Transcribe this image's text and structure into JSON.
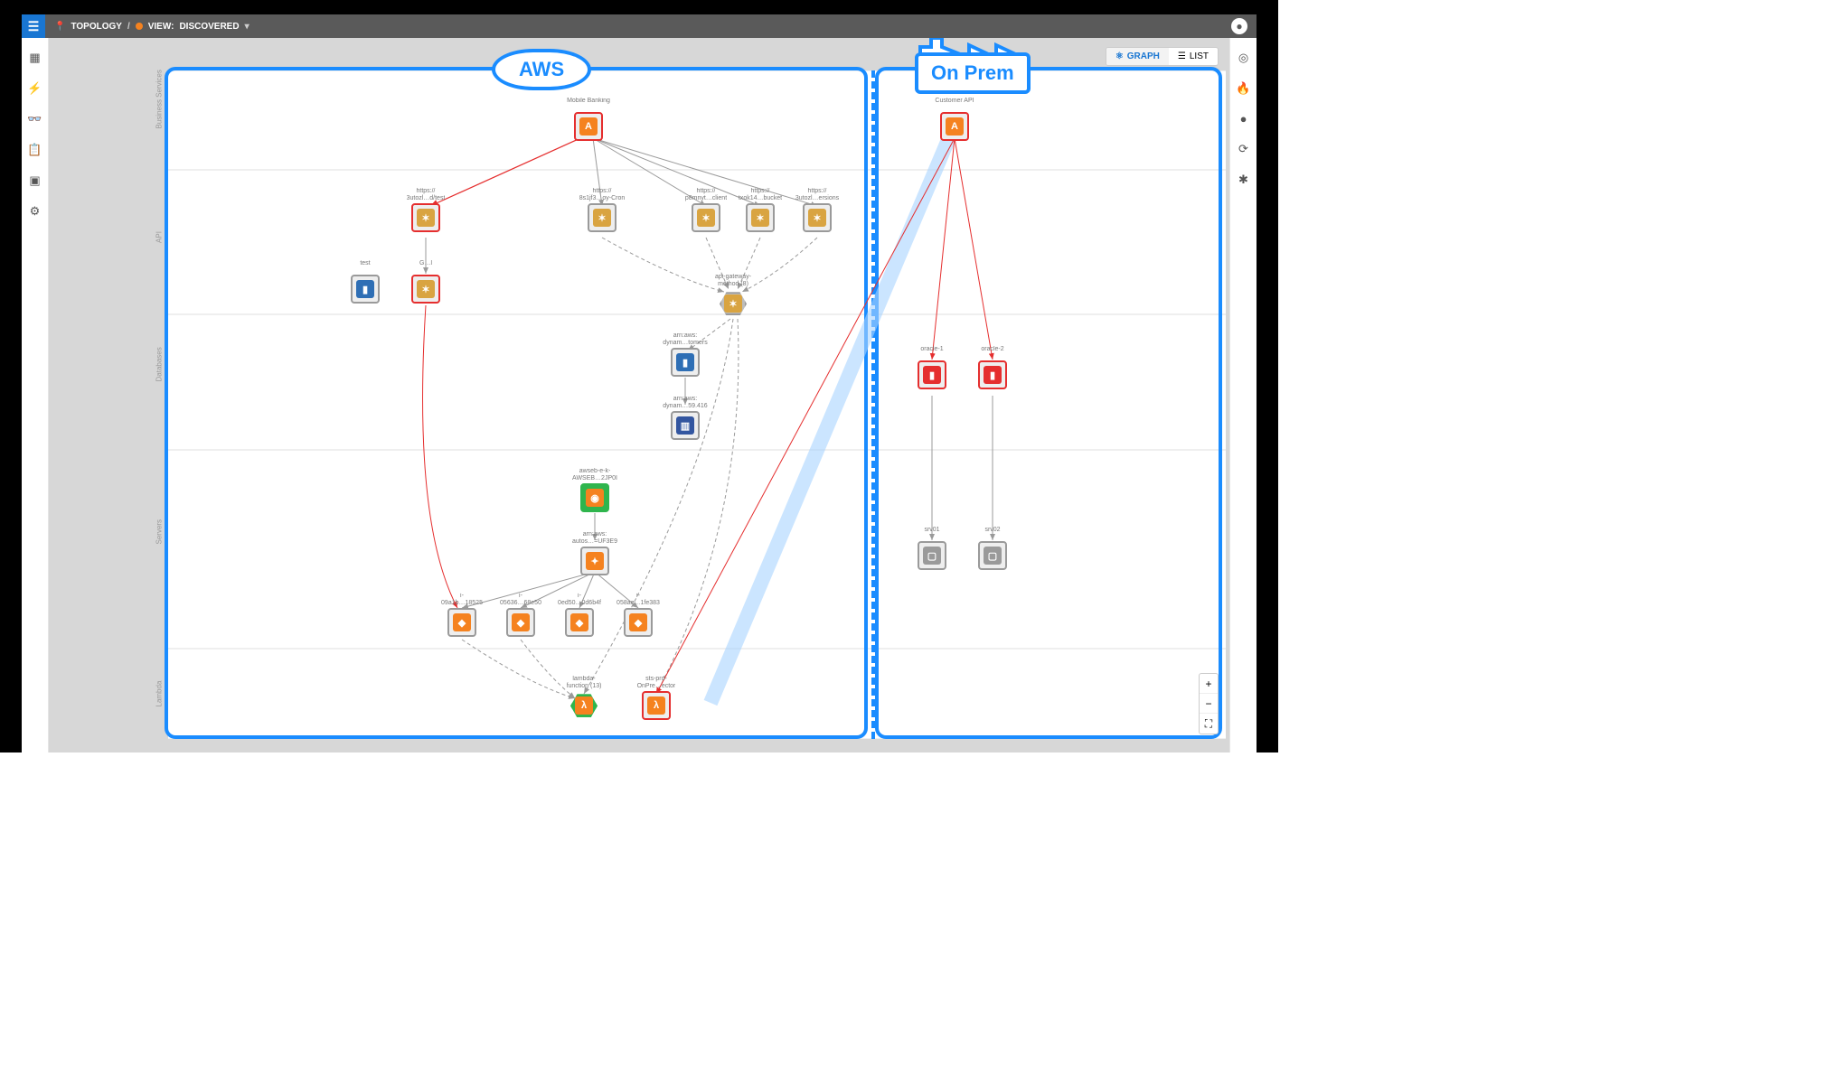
{
  "header": {
    "breadcrumb_root": "TOPOLOGY",
    "sep": "/",
    "view_prefix": "VIEW:",
    "view_name": "DISCOVERED"
  },
  "view_toggle": {
    "graph": "GRAPH",
    "list": "LIST"
  },
  "groups": {
    "aws": "AWS",
    "onprem": "On Prem"
  },
  "lanes": {
    "biz": "Business Services",
    "api": "API",
    "db": "Databases",
    "srv": "Servers",
    "lambda": "Lambda"
  },
  "nodes": {
    "mobile": {
      "l": "Mobile Banking",
      "cls": "red",
      "icon": "app",
      "txt": "A"
    },
    "cust": {
      "l": "Customer API",
      "cls": "red",
      "icon": "app",
      "txt": "A"
    },
    "h1": {
      "l": "https://\n3utozl…d/test",
      "cls": "red",
      "icon": "api",
      "txt": "✶"
    },
    "h2": {
      "l": "https://\n8s1jf3…oy-Cron",
      "cls": "",
      "icon": "api",
      "txt": "✶"
    },
    "h3": {
      "l": "https://\np8mnyt…client",
      "cls": "",
      "icon": "api",
      "txt": "✶"
    },
    "h4": {
      "l": "https://\ntxok14…bucket",
      "cls": "",
      "icon": "api",
      "txt": "✶"
    },
    "h5": {
      "l": "https://\n3utozl…ersions",
      "cls": "",
      "icon": "api",
      "txt": "✶"
    },
    "test": {
      "l": "test",
      "cls": "",
      "icon": "db",
      "txt": "▮"
    },
    "gl": {
      "l": "G…l",
      "cls": "red",
      "icon": "api",
      "txt": "✶"
    },
    "apim": {
      "l": "api-gateway-\nmethod (8)",
      "cls": "hex",
      "icon": "api",
      "txt": "✶"
    },
    "dyn1": {
      "l": "arn:aws:\ndynam…tomers",
      "cls": "",
      "icon": "db",
      "txt": "▮"
    },
    "dyn2": {
      "l": "arn:aws:\ndynam…59.416",
      "cls": "",
      "icon": "dyn",
      "txt": "▥"
    },
    "or1": {
      "l": "oracle-1",
      "cls": "red",
      "icon": "dbred",
      "txt": "▮"
    },
    "or2": {
      "l": "oracle-2",
      "cls": "red",
      "icon": "dbred",
      "txt": "▮"
    },
    "eb": {
      "l": "awseb-e-k-\nAWSEB…2JP0I",
      "cls": "green",
      "icon": "lb",
      "txt": "◉"
    },
    "asg": {
      "l": "arn:aws:\nautos…=UF3E9",
      "cls": "",
      "icon": "ec2",
      "txt": "✦"
    },
    "i1": {
      "l": "i-\n09a1b…18525",
      "cls": "",
      "icon": "ec2",
      "txt": "◆"
    },
    "i2": {
      "l": "i-\n05636…68e50",
      "cls": "",
      "icon": "ec2",
      "txt": "◆"
    },
    "i3": {
      "l": "i-\n0ed50…0d6b4f",
      "cls": "",
      "icon": "ec2",
      "txt": "◆"
    },
    "i4": {
      "l": "i-\n058ae…1fe383",
      "cls": "",
      "icon": "ec2",
      "txt": "◆"
    },
    "s1": {
      "l": "srv01",
      "cls": "",
      "icon": "srv",
      "txt": "▢"
    },
    "s2": {
      "l": "srv02",
      "cls": "",
      "icon": "srv",
      "txt": "▢"
    },
    "lf": {
      "l": "lambda-\nfunction (13)",
      "cls": "hex green",
      "icon": "lambda",
      "txt": "λ"
    },
    "lp": {
      "l": "sts-prd-\nOnPre…ector",
      "cls": "red",
      "icon": "lambda",
      "txt": "λ"
    }
  },
  "colors": {
    "accent": "#1a8cff",
    "alert": "#e52e2e",
    "ok": "#2fb54d",
    "aws": "#f5821f"
  },
  "zoom": {
    "in": "+",
    "out": "−",
    "fit": "⛶"
  }
}
